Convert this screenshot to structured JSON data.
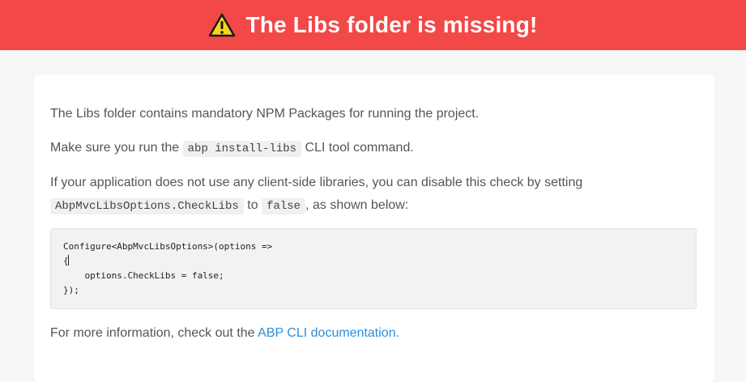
{
  "banner": {
    "icon": "warning-icon",
    "title": "The Libs folder is missing!",
    "color": "#f24848"
  },
  "card": {
    "p1": "The Libs folder contains mandatory NPM Packages for running the project.",
    "p2": {
      "before": "Make sure you run the ",
      "code": "abp install-libs",
      "after": " CLI tool command."
    },
    "p3": {
      "line1": "If your application does not use any client-side libraries, you can disable this check by setting",
      "code1": "AbpMvcLibsOptions.CheckLibs",
      "mid": " to ",
      "code2": "false",
      "after": ", as shown below:"
    },
    "code_block": {
      "line1": "Configure<AbpMvcLibsOptions>(options =>",
      "line2": "{",
      "line3": "    options.CheckLibs = false;",
      "line4": "});"
    },
    "p4": {
      "before": "For more information, check out the ",
      "link": "ABP CLI documentation.",
      "link_color": "#2e8fd6"
    }
  }
}
